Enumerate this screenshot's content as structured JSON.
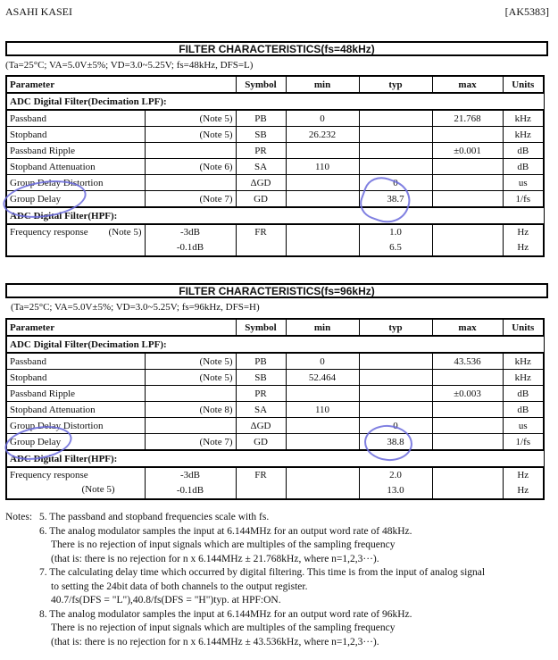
{
  "header": {
    "company": "ASAHI KASEI",
    "part_number": "[AK5383]"
  },
  "tables": [
    {
      "title": "FILTER CHARACTERISTICS(fs=48kHz)",
      "conditions": "(Ta=25°C; VA=5.0V±5%; VD=3.0~5.25V; fs=48kHz, DFS=L)",
      "columns": [
        "Parameter",
        "Symbol",
        "min",
        "typ",
        "max",
        "Units"
      ],
      "group1": "ADC Digital Filter(Decimation LPF):",
      "rows": [
        {
          "param": "Passband",
          "note": "(Note 5)",
          "symbol": "PB",
          "min": "0",
          "typ": "",
          "max": "21.768",
          "units": "kHz"
        },
        {
          "param": "Stopband",
          "note": "(Note 5)",
          "symbol": "SB",
          "min": "26.232",
          "typ": "",
          "max": "",
          "units": "kHz"
        },
        {
          "param": "Passband Ripple",
          "note": "",
          "symbol": "PR",
          "min": "",
          "typ": "",
          "max": "±0.001",
          "units": "dB"
        },
        {
          "param": "Stopband Attenuation",
          "note": "(Note 6)",
          "symbol": "SA",
          "min": "110",
          "typ": "",
          "max": "",
          "units": "dB"
        },
        {
          "param": "Group Delay Distortion",
          "note": "",
          "symbol": "ΔGD",
          "min": "",
          "typ": "0",
          "max": "",
          "units": "us"
        },
        {
          "param": "Group Delay",
          "note": "(Note 7)",
          "symbol": "GD",
          "min": "",
          "typ": "38.7",
          "max": "",
          "units": "1/fs"
        }
      ],
      "group2": "ADC Digital Filter(HPF):",
      "hpf": {
        "param": "Frequency response",
        "note": "(Note 5)",
        "conditions": [
          "-3dB",
          "-0.1dB"
        ],
        "symbol": "FR",
        "typ": [
          "1.0",
          "6.5"
        ],
        "units": [
          "Hz",
          "Hz"
        ]
      }
    },
    {
      "title": "FILTER CHARACTERISTICS(fs=96kHz)",
      "conditions": "(Ta=25°C; VA=5.0V±5%; VD=3.0~5.25V; fs=96kHz, DFS=H)",
      "columns": [
        "Parameter",
        "Symbol",
        "min",
        "typ",
        "max",
        "Units"
      ],
      "group1": "ADC Digital Filter(Decimation LPF):",
      "rows": [
        {
          "param": "Passband",
          "note": "(Note 5)",
          "symbol": "PB",
          "min": "0",
          "typ": "",
          "max": "43.536",
          "units": "kHz"
        },
        {
          "param": "Stopband",
          "note": "(Note 5)",
          "symbol": "SB",
          "min": "52.464",
          "typ": "",
          "max": "",
          "units": "kHz"
        },
        {
          "param": "Passband Ripple",
          "note": "",
          "symbol": "PR",
          "min": "",
          "typ": "",
          "max": "±0.003",
          "units": "dB"
        },
        {
          "param": "Stopband Attenuation",
          "note": "(Note 8)",
          "symbol": "SA",
          "min": "110",
          "typ": "",
          "max": "",
          "units": "dB"
        },
        {
          "param": "Group Delay Distortion",
          "note": "",
          "symbol": "ΔGD",
          "min": "",
          "typ": "0",
          "max": "",
          "units": "us"
        },
        {
          "param": "Group Delay",
          "note": "(Note 7)",
          "symbol": "GD",
          "min": "",
          "typ": "38.8",
          "max": "",
          "units": "1/fs"
        }
      ],
      "group2": "ADC Digital Filter(HPF):",
      "hpf": {
        "param": "Frequency response",
        "note": "(Note 5)",
        "conditions": [
          "-3dB",
          "-0.1dB"
        ],
        "symbol": "FR",
        "typ": [
          "2.0",
          "13.0"
        ],
        "units": [
          "Hz",
          "Hz"
        ]
      }
    }
  ],
  "notes": {
    "label": "Notes:",
    "items": [
      {
        "lines": [
          "5. The passband and stopband frequencies scale with fs."
        ]
      },
      {
        "lines": [
          "6. The analog modulator samples the input at 6.144MHz for an output word rate of 48kHz.",
          "There is no rejection of input signals which are multiples of the sampling frequency",
          "(that is: there is no rejection for n x 6.144MHz ± 21.768kHz, where n=1,2,3···)."
        ]
      },
      {
        "lines": [
          "7. The calculating delay time which occurred by digital filtering. This time is from the input of analog signal",
          "to setting the 24bit data of both channels to the output register.",
          "40.7/fs(DFS = \"L\"),40.8/fs(DFS = \"H\")typ. at HPF:ON."
        ]
      },
      {
        "lines": [
          "8. The analog modulator samples the input at 6.144MHz for an output word rate of 96kHz.",
          "There is no rejection of input signals which are multiples of the sampling frequency",
          "(that is: there is no rejection for n x 6.144MHz ± 43.536kHz, where n=1,2,3···)."
        ]
      }
    ]
  },
  "annotations": {
    "highlight_color": "#6a6adc"
  }
}
